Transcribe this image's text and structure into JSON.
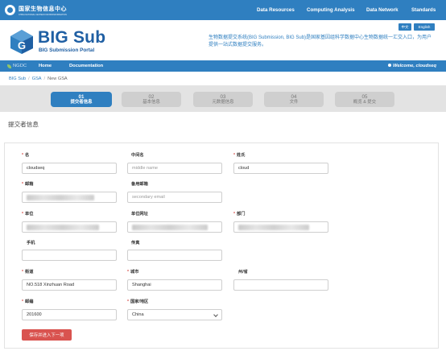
{
  "topbar": {
    "org_name": "国家生物信息中心",
    "org_sub": "CHINA NATIONAL CENTER FOR BIOINFORMATION",
    "nav": [
      "Data Resources",
      "Computing Analysis",
      "Data Network",
      "Standards"
    ]
  },
  "banner": {
    "title": "BIG Sub",
    "subtitle": "BIG Submission Portal",
    "description": "生物数据提交系统(BIG Submission, BIG Sub)是国家基因组科学数据中心生物数据统一汇交入口，为用户提供一站式数据提交服务。",
    "lang_zh": "中文",
    "lang_en": "English",
    "logo_letter": "G"
  },
  "navbar": {
    "ngdc": "NGDC",
    "home": "Home",
    "documentation": "Documentation",
    "welcome": "Welcome, cloudseq"
  },
  "breadcrumb": [
    "BIG Sub",
    "GSA",
    "New GSA"
  ],
  "steps": [
    {
      "num": "01",
      "label": "提交者信息"
    },
    {
      "num": "02",
      "label": "基本信息"
    },
    {
      "num": "03",
      "label": "元数据信息"
    },
    {
      "num": "04",
      "label": "文件"
    },
    {
      "num": "05",
      "label": "概览 & 提交"
    }
  ],
  "page_title": "提交者信息",
  "form": {
    "first_name": {
      "label": "名",
      "value": "cloudseq"
    },
    "middle_name": {
      "label": "中间名",
      "placeholder": "middle name"
    },
    "last_name": {
      "label": "姓氏",
      "value": "cloud"
    },
    "email": {
      "label": "邮箱"
    },
    "secondary_email": {
      "label": "备用邮箱",
      "placeholder": "secondary email"
    },
    "organization": {
      "label": "单位"
    },
    "org_url": {
      "label": "单位网址"
    },
    "department": {
      "label": "部门"
    },
    "phone": {
      "label": "手机"
    },
    "fax": {
      "label": "传真"
    },
    "street": {
      "label": "街道",
      "value": "NO.518 Xinzhuan Road"
    },
    "city": {
      "label": "城市",
      "value": "Shanghai"
    },
    "state": {
      "label": "州/省"
    },
    "postal_code": {
      "label": "邮编",
      "value": "201600"
    },
    "country": {
      "label": "国家/地区",
      "value": "China"
    },
    "save_label": "保存并进入下一项"
  },
  "colors": {
    "primary": "#2f7fc0",
    "required": "#d9534f",
    "step_inactive": "#cfcfcf",
    "steps_bg": "#e3e3e3"
  },
  "icons": [
    "org-logo-icon",
    "big-sub-logo-icon",
    "leaf-icon",
    "user-icon",
    "chevron-down-icon"
  ]
}
